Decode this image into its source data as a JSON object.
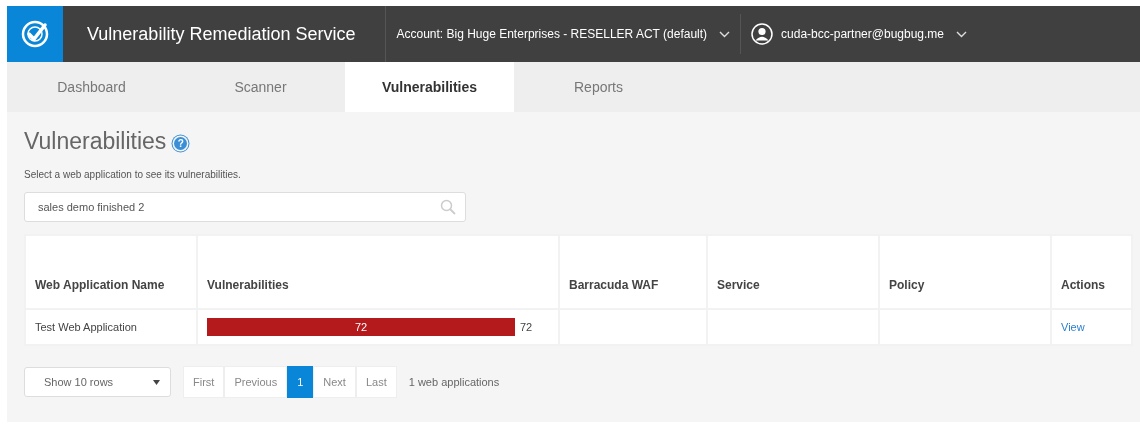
{
  "header": {
    "title": "Vulnerability Remediation Service",
    "account": "Account: Big Huge Enterprises - RESELLER ACT (default)",
    "user": "cuda-bcc-partner@bugbug.me"
  },
  "tabs": [
    {
      "label": "Dashboard",
      "selected": false
    },
    {
      "label": "Scanner",
      "selected": false
    },
    {
      "label": "Vulnerabilities",
      "selected": true
    },
    {
      "label": "Reports",
      "selected": false
    }
  ],
  "page": {
    "title": "Vulnerabilities",
    "help": "?",
    "hint": "Select a web application to see its vulnerabilities."
  },
  "search": {
    "value": "sales demo finished 2"
  },
  "table": {
    "columns": [
      "Web Application Name",
      "Vulnerabilities",
      "Barracuda WAF",
      "Service",
      "Policy",
      "Actions"
    ],
    "rows": [
      {
        "name": "Test Web Application",
        "bar_label": "72",
        "count": "72",
        "action": "View"
      }
    ]
  },
  "pager": {
    "rows_select": "Show 10 rows",
    "buttons": [
      {
        "label": "First",
        "selected": false
      },
      {
        "label": "Previous",
        "selected": false
      },
      {
        "label": "1",
        "selected": true
      },
      {
        "label": "Next",
        "selected": false
      },
      {
        "label": "Last",
        "selected": false
      }
    ],
    "summary": "1 web applications"
  }
}
